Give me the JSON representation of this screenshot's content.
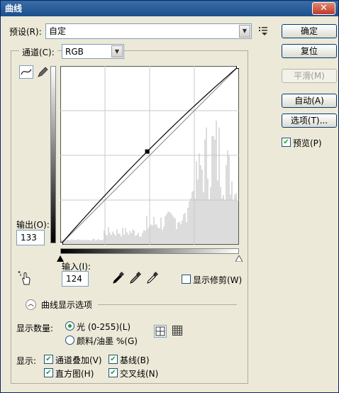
{
  "window": {
    "title": "曲线",
    "close": "✕"
  },
  "preset": {
    "label": "预设(R):",
    "value": "自定"
  },
  "channel": {
    "label": "通道(C):",
    "value": "RGB"
  },
  "buttons": {
    "ok": "确定",
    "reset": "复位",
    "smooth": "平滑(M)",
    "auto": "自动(A)",
    "options": "选项(T)..."
  },
  "preview": {
    "label": "预览(P)",
    "checked": true
  },
  "output": {
    "label": "输出(O):",
    "value": "133"
  },
  "input": {
    "label": "输入(I):",
    "value": "124"
  },
  "show_clipping": {
    "label": "显示修剪(W)",
    "checked": false
  },
  "curve_options": {
    "label": "曲线显示选项"
  },
  "show_amount": {
    "label": "显示数量:",
    "options": [
      {
        "label": "光 (0-255)(L)",
        "selected": true
      },
      {
        "label": "颜料/油墨 %(G)",
        "selected": false
      }
    ]
  },
  "show": {
    "label": "显示:",
    "checkboxes": [
      {
        "label": "通道叠加(V)",
        "checked": true
      },
      {
        "label": "基线(B)",
        "checked": true
      },
      {
        "label": "直方图(H)",
        "checked": true
      },
      {
        "label": "交叉线(N)",
        "checked": true
      }
    ]
  },
  "curve": {
    "input": 124,
    "output": 133
  },
  "icons": {
    "curve_tool": "curve-tool-icon",
    "pencil_tool": "pencil-tool-icon",
    "preset_menu": "preset-menu-icon",
    "hand_target": "on-image-adjust-icon",
    "eyedropper_black": "black-eyedropper-icon",
    "eyedropper_gray": "gray-eyedropper-icon",
    "eyedropper_white": "white-eyedropper-icon",
    "grid_simple": "simple-grid-icon",
    "grid_detailed": "detailed-grid-icon",
    "collapse": "collapse-chevron-icon"
  }
}
